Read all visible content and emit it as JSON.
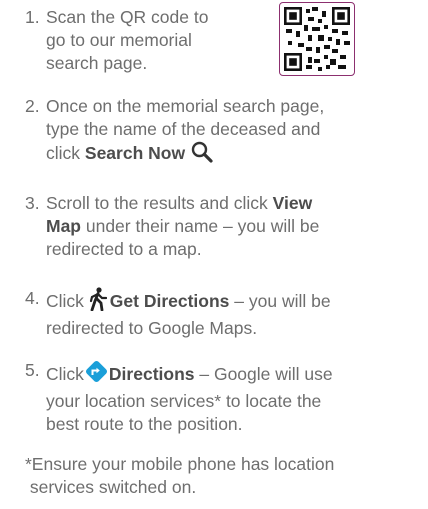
{
  "steps": [
    {
      "num": "1.",
      "lines": [
        "Scan the QR code to",
        "go to our memorial",
        "search page."
      ]
    },
    {
      "num": "2.",
      "line1": "Once on the memorial search page,",
      "line2": "type the name of the deceased and",
      "line3_pre": "click ",
      "line3_bold": "Search Now",
      "icon": "search-icon"
    },
    {
      "num": "3.",
      "line1_pre": "Scroll to the results and click ",
      "line1_bold": "View",
      "line2_bold": "Map",
      "line2_post": " under their name – you will be",
      "line3": "redirected to a map."
    },
    {
      "num": "4.",
      "line1_pre": "Click ",
      "line1_bold": "Get Directions",
      "line1_post": " – you will be",
      "line2": "redirected to Google Maps.",
      "icon": "walking-person-icon"
    },
    {
      "num": "5.",
      "line1_pre": "Click",
      "line1_bold": "Directions",
      "line1_post": " – Google will use",
      "line2": "your location services* to locate the",
      "line3": "best route to the position.",
      "icon": "directions-diamond-icon"
    }
  ],
  "note": {
    "line1": "*Ensure your mobile phone has location",
    "line2": " services switched on."
  },
  "colors": {
    "text": "#6e6e6e",
    "bold": "#4d4d4d",
    "qr_border": "#8c2f6f",
    "directions_icon": "#1a9fd9"
  }
}
